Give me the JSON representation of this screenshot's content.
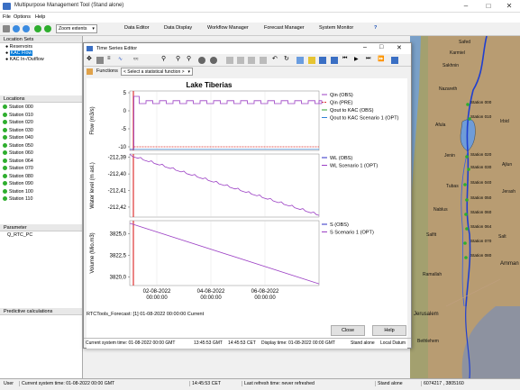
{
  "window": {
    "title": "Multipurpose Management Tool (Stand alone)"
  },
  "menu": [
    "File",
    "Options",
    "Help"
  ],
  "toolbar": {
    "zoom_label": "Zoom extents"
  },
  "top_tabs": [
    "Data Editor",
    "Data Display",
    "Workflow Manager",
    "Forecast Manager",
    "System Monitor"
  ],
  "location_sets": {
    "header": "Location Sets",
    "items": [
      "Reservoirs",
      "KAC Flow",
      "KAC In-/Outflow"
    ],
    "selected": "KAC Flow"
  },
  "locations": {
    "header": "Locations",
    "items": [
      "Station 000",
      "Station 010",
      "Station 020",
      "Station 030",
      "Station 040",
      "Station 050",
      "Station 060",
      "Station 064",
      "Station 070",
      "Station 080",
      "Station 090",
      "Station 100",
      "Station 110"
    ]
  },
  "parameters": {
    "header": "Parameter",
    "items": [
      "Q_RTC_PC"
    ]
  },
  "predictive": {
    "header": "Predictive calculations"
  },
  "dialog": {
    "title": "Time Series Editor",
    "functions_label": "Functions",
    "functions_select": "< Select a statistical function >",
    "forecast_text": "RTCTools_Forecast: [1] 01-08-2022 00:00:00 Current",
    "close_label": "Close",
    "help_label": "Help",
    "status": {
      "current_system_time": "Current system time: 01-08-2022 00:00 GMT",
      "time_gmt": "13:45:53 GMT",
      "time_cet": "14:45:53 CET",
      "display_time": "Display time: 01-08-2022 00:00 GMT",
      "mode": "Stand alone",
      "datum": "Local Datum"
    }
  },
  "map": {
    "places": [
      "Safed",
      "Karmiel",
      "Sakhnin",
      "Nazareth",
      "Afula",
      "Irbid",
      "Ajlun",
      "Jerash",
      "Jenin",
      "Tubas",
      "Nablus",
      "Salfit",
      "Ramallah",
      "Jerusalem",
      "Bethlehem",
      "Amman",
      "Salt"
    ],
    "stations": [
      "Station 000",
      "Station 010",
      "Station 020",
      "Station 030",
      "Station 040",
      "Station 050",
      "Station 060",
      "Station 064",
      "Station 070",
      "Station 080",
      "Station 090",
      "Station 100",
      "Station 110"
    ]
  },
  "statusbar": {
    "user": "User",
    "current_time": "Current system time: 01-08-2022 00:00 GMT",
    "cet": "14:45:53 CET",
    "refresh": "Last refresh time: never refreshed",
    "mode": "Stand alone",
    "coords": "6074217 , 3805160"
  },
  "chart_data": {
    "title": "Lake Tiberias",
    "type": "line",
    "x_ticks": [
      "02-08-2022 00:00:00",
      "04-08-2022 00:00:00",
      "06-08-2022 00:00:00"
    ],
    "panels": [
      {
        "ylabel": "Flow (m3/s)",
        "yticks": [
          5,
          0,
          -5,
          -10
        ],
        "ylim": [
          -11,
          5.5
        ],
        "legend": [
          "Qin (OBS)",
          "Qin (PRE)",
          "Qout to KAC (OBS)",
          "Qout to KAC Scenario 1 (OPT)"
        ],
        "series": [
          {
            "name": "Qin (OBS)",
            "color": "#9b3fc4",
            "style": "solid",
            "approx": "step pattern around 2.5"
          },
          {
            "name": "Qin (PRE)",
            "color": "#d93030",
            "style": "dashed",
            "approx": "constant -10"
          },
          {
            "name": "Qout to KAC (OBS)",
            "color": "#2e9e2e",
            "style": "solid",
            "approx": "none visible"
          },
          {
            "name": "Qout to KAC Scenario 1 (OPT)",
            "color": "#2e7fd6",
            "style": "solid",
            "approx": "constant -10.7"
          }
        ]
      },
      {
        "ylabel": "Water level (m asl.)",
        "yticks": [
          "-212,39",
          "-212,40",
          "-212,41",
          "-212,42"
        ],
        "ylim": [
          -212.426,
          -212.388
        ],
        "legend": [
          "WL (OBS)",
          "WL Scenario 1 (OPT)"
        ],
        "series": [
          {
            "name": "WL (OBS)",
            "color": "#2e2ec4",
            "style": "solid",
            "approx": "none visible"
          },
          {
            "name": "WL Scenario 1 (OPT)",
            "color": "#9b3fc4",
            "style": "solid",
            "approx": "decreasing -212.389 to -212.425"
          }
        ]
      },
      {
        "ylabel": "Volume (Mio.m3)",
        "yticks": [
          "3825,0",
          "3822,5",
          "3820,0"
        ],
        "ylim": [
          3819.0,
          3826.5
        ],
        "legend": [
          "S (OBS)",
          "S Scenario 1 (OPT)"
        ],
        "series": [
          {
            "name": "S (OBS)",
            "color": "#2e2ec4",
            "style": "solid",
            "approx": "none visible"
          },
          {
            "name": "S Scenario 1 (OPT)",
            "color": "#9b3fc4",
            "style": "solid",
            "approx": "decreasing 3826.2 to 3819.2"
          }
        ]
      }
    ]
  }
}
